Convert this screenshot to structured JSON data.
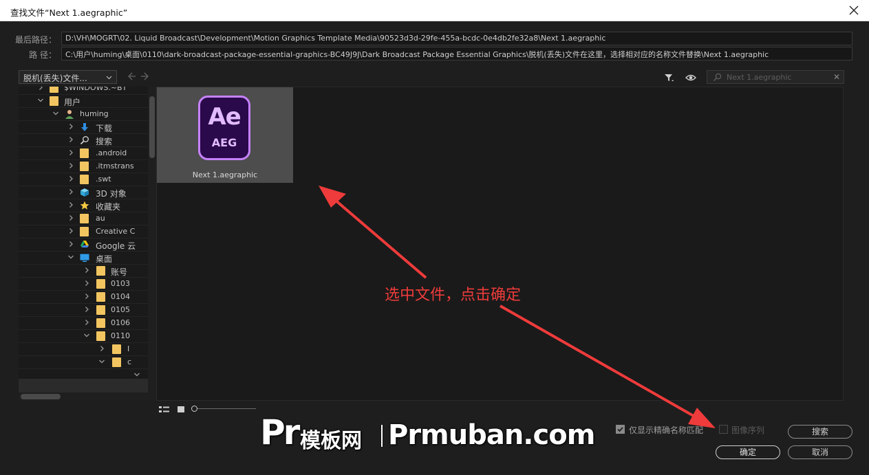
{
  "window": {
    "title": "查找文件“Next 1.aegraphic”"
  },
  "paths": {
    "last_label": "最后路径：",
    "last_value": "D:\\VH\\MOGRT\\02. Liquid Broadcast\\Development\\Motion Graphics Template Media\\90523d3d-29fe-455a-bcdc-0e4db2fe32a8\\Next 1.aegraphic",
    "path_label": "路 径：",
    "path_value": "C:\\用户\\huming\\桌面\\0110\\dark-broadcast-package-essential-graphics-BC49J9J\\Dark Broadcast Package Essential Graphics\\脱机(丢失)文件在这里，选择相对应的名称文件替换\\Next 1.aegraphic"
  },
  "location_dropdown": {
    "value": "脱机(丢失)文件..."
  },
  "tree": {
    "items": [
      {
        "label": "$WINDOWS.~BT",
        "icon": "folder-icon"
      },
      {
        "label": "用户",
        "icon": "folder-icon"
      },
      {
        "label": "huming",
        "icon": "user-icon"
      },
      {
        "label": "下载",
        "icon": "download-icon"
      },
      {
        "label": "搜索",
        "icon": "search-icon"
      },
      {
        "label": ".android",
        "icon": "folder-icon"
      },
      {
        "label": ".itmstrans",
        "icon": "folder-icon"
      },
      {
        "label": ".swt",
        "icon": "folder-icon"
      },
      {
        "label": "3D 对象",
        "icon": "cube-icon"
      },
      {
        "label": "收藏夹",
        "icon": "star-icon"
      },
      {
        "label": "au",
        "icon": "folder-icon"
      },
      {
        "label": "Creative C",
        "icon": "folder-icon"
      },
      {
        "label": "Google 云",
        "icon": "google-drive-icon"
      },
      {
        "label": "桌面",
        "icon": "desktop-icon"
      },
      {
        "label": "账号",
        "icon": "folder-icon"
      },
      {
        "label": "0103",
        "icon": "folder-icon"
      },
      {
        "label": "0104",
        "icon": "folder-icon"
      },
      {
        "label": "0105",
        "icon": "folder-icon"
      },
      {
        "label": "0106",
        "icon": "folder-icon"
      },
      {
        "label": "0110",
        "icon": "folder-icon"
      },
      {
        "label": "I",
        "icon": "folder-icon"
      },
      {
        "label": "c",
        "icon": "folder-icon"
      }
    ]
  },
  "search": {
    "placeholder": "Next 1.aegraphic"
  },
  "file_tile": {
    "icon_text": "Ae",
    "icon_sub": "AEG",
    "name": "Next 1.aegraphic"
  },
  "options": {
    "exact_match_label": "仅显示精确名称匹配",
    "image_sequence_label": "图像序列"
  },
  "buttons": {
    "search": "搜索",
    "ok": "确定",
    "cancel": "取消"
  },
  "annotation": {
    "text": "选中文件，点击确定"
  },
  "watermark": {
    "pr": "Pr",
    "cn": "模板网",
    "domain": "Prmuban.com"
  },
  "colors": {
    "accent_annotation": "#ef3b3b",
    "ae_purple": "#c682ff",
    "ae_bg": "#2a0a4a",
    "folder": "#f2c560"
  }
}
